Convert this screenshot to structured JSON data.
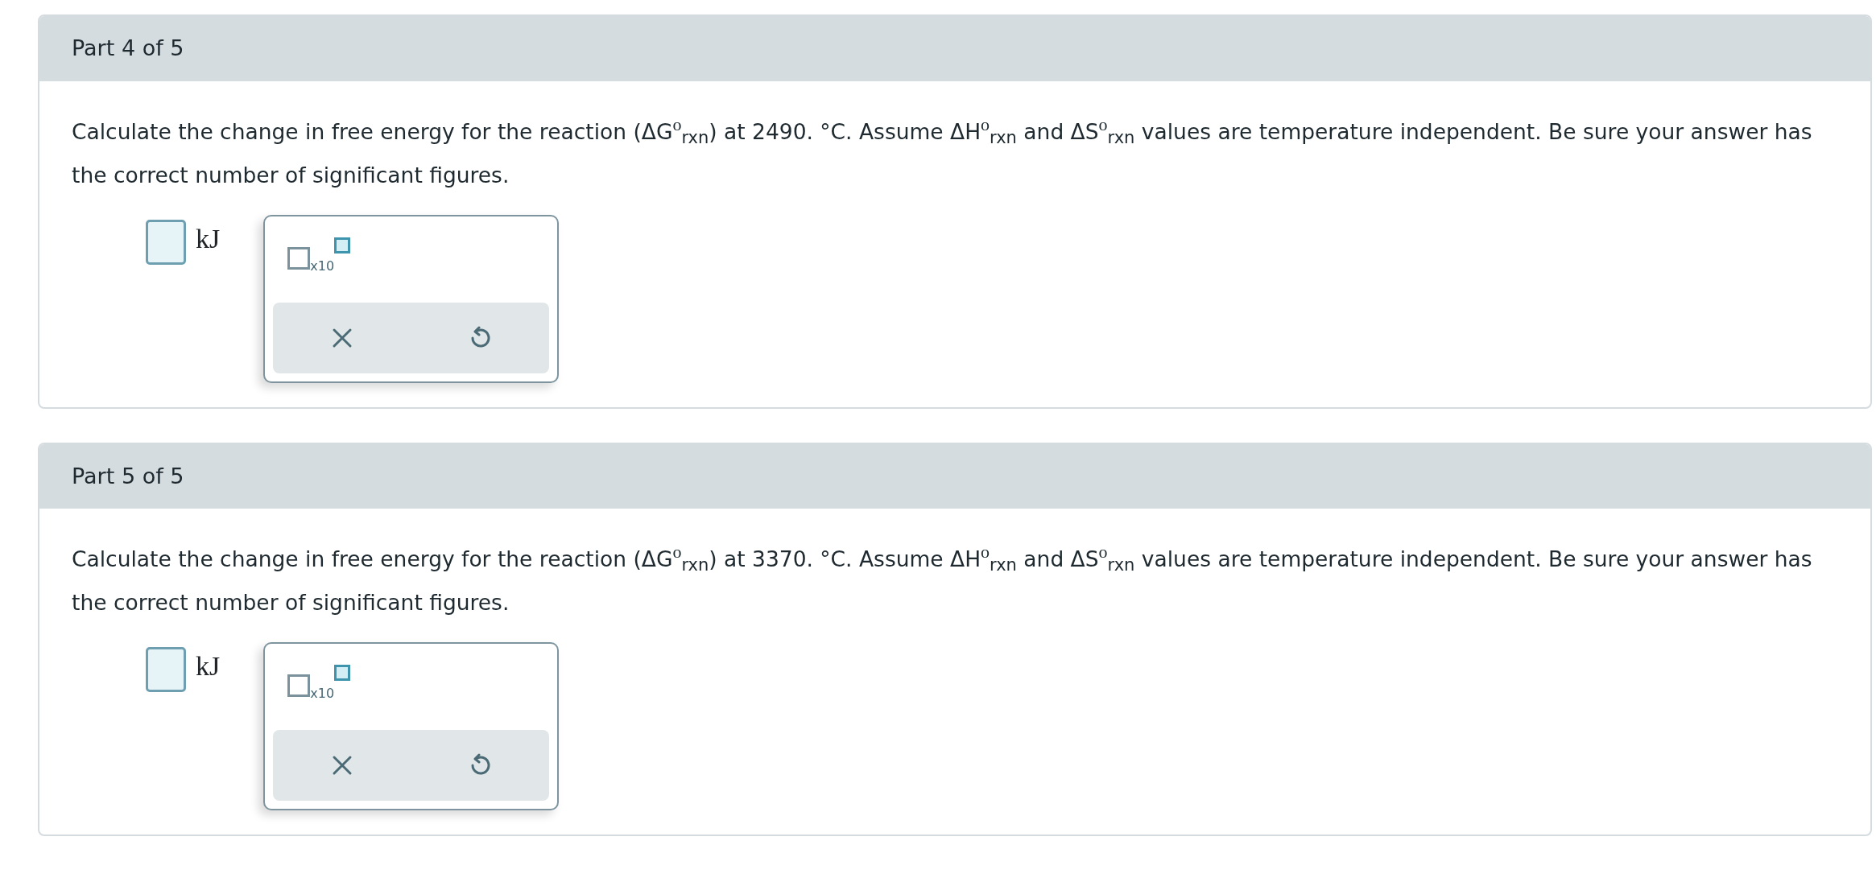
{
  "parts": [
    {
      "header": "Part 4 of 5",
      "question": "Calculate the change in free energy for the reaction (ΔG$^{o}$$_{rxn}$) at 2490. °C. Assume ΔH$^{o}$$_{rxn}$ and ΔS$^{o}$$_{rxn}$ values are temperature independent. Be sure your answer has the correct number of significant figures.",
      "unit": "kJ",
      "times_ten": "x10"
    },
    {
      "header": "Part 5 of 5",
      "question": "Calculate the change in free energy for the reaction (ΔG$^{o}$$_{rxn}$) at 3370. °C. Assume ΔH$^{o}$$_{rxn}$ and ΔS$^{o}$$_{rxn}$ values are temperature independent. Be sure your answer has the correct number of significant figures.",
      "unit": "kJ",
      "times_ten": "x10"
    }
  ]
}
